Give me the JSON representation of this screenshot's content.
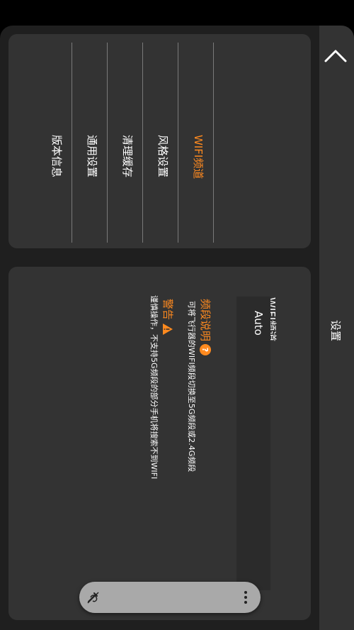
{
  "header": {
    "title": "设置",
    "back_icon": "chevron-up-icon"
  },
  "nav": {
    "items": [
      {
        "label": "WIFI频道",
        "active": true
      },
      {
        "label": "风格设置",
        "active": false
      },
      {
        "label": "清理缓存",
        "active": false
      },
      {
        "label": "通用设置",
        "active": false
      },
      {
        "label": "版本信息",
        "active": false
      }
    ]
  },
  "content": {
    "wifi_title": "WIFI频道",
    "select_value": "Auto",
    "info_title": "频段说明",
    "info_text": "可将飞行器的WIFI频段切换至5G频段或2.4G频段",
    "warning_title": "警告",
    "warning_text": "谨慎操作，不支持5G频段的部分手机将搜索不到WIFI"
  },
  "bottom_bar": {
    "left_icon": "edit-icon",
    "right_icon": "more-vertical-icon"
  },
  "colors": {
    "accent": "#ff8a1f",
    "background": "#1f1f1f",
    "card": "#333333"
  }
}
